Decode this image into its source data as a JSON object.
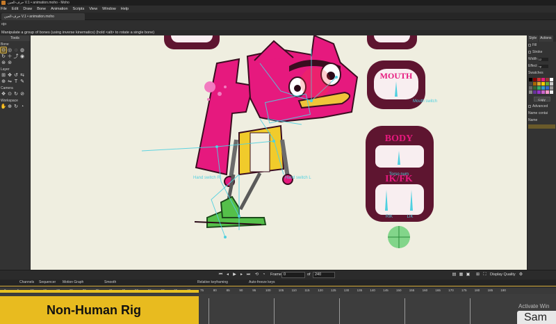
{
  "window": {
    "title": "حرف-العين V.1 • animation.moho - Moho"
  },
  "menu": [
    "File",
    "Edit",
    "Draw",
    "Bone",
    "Animation",
    "Scripts",
    "View",
    "Window",
    "Help"
  ],
  "document_tab": "حرف-العين V.1 • animation.moho",
  "tool_options_label": "ojo",
  "status": "Manipulate a group of bones (using inverse kinematics) (hold <alt> to rotate a single bone)",
  "tools_panel": {
    "title": "Tools",
    "groups": [
      "Bone",
      "Layer",
      "Camera",
      "Workspace"
    ]
  },
  "canvas": {
    "mouth_label": "MOUTH",
    "mouth_switch_label": "Mouth switch",
    "body_label": "BODY",
    "torso_label": "Torso num",
    "ikfk_label": "IK/FK",
    "rik_label": "RIK",
    "lik_label": "LIK",
    "hand_switch_label": "Hand switch L",
    "hand_switch_r_label": "Hand switch R"
  },
  "style_panel": {
    "tabs": [
      "Style",
      "Actions"
    ],
    "fill_label": "Fill",
    "stroke_label": "Stroke",
    "width_label": "Width",
    "width_value": "12",
    "effect_label": "Effect",
    "effect_value": "<p",
    "swatches_label": "Swatches",
    "copy_label": "Copy",
    "advanced_label": "Advanced",
    "name_label": "Name",
    "name_contains": "Name contai"
  },
  "playback": {
    "frame_label": "Frame",
    "frame_value": "0",
    "of_label": "of",
    "total_value": "240",
    "display_quality": "Display Quality"
  },
  "timeline": {
    "tabs": [
      "Channels",
      "Sequencer",
      "Motion Graph",
      "Smooth",
      "Relative keyframing",
      "Auto-freeze keys"
    ],
    "ticks": [
      "0",
      "5",
      "10",
      "15",
      "20",
      "25",
      "30",
      "35",
      "40",
      "45",
      "50",
      "55",
      "60",
      "65",
      "70",
      "75",
      "80",
      "85",
      "90",
      "95",
      "100",
      "105",
      "110",
      "115",
      "120",
      "125",
      "130",
      "135",
      "140",
      "145",
      "150",
      "155",
      "160",
      "165",
      "170",
      "175",
      "180",
      "185",
      "190"
    ]
  },
  "overlay": {
    "caption": "Non-Human Rig",
    "activate_windows": "Activate Win",
    "sam": "Sam"
  },
  "colors": {
    "accent": "#e8bb1f",
    "character_pink": "#e6197e",
    "panel_maroon": "#5e1530",
    "bone_cyan": "#4fd0e0"
  }
}
